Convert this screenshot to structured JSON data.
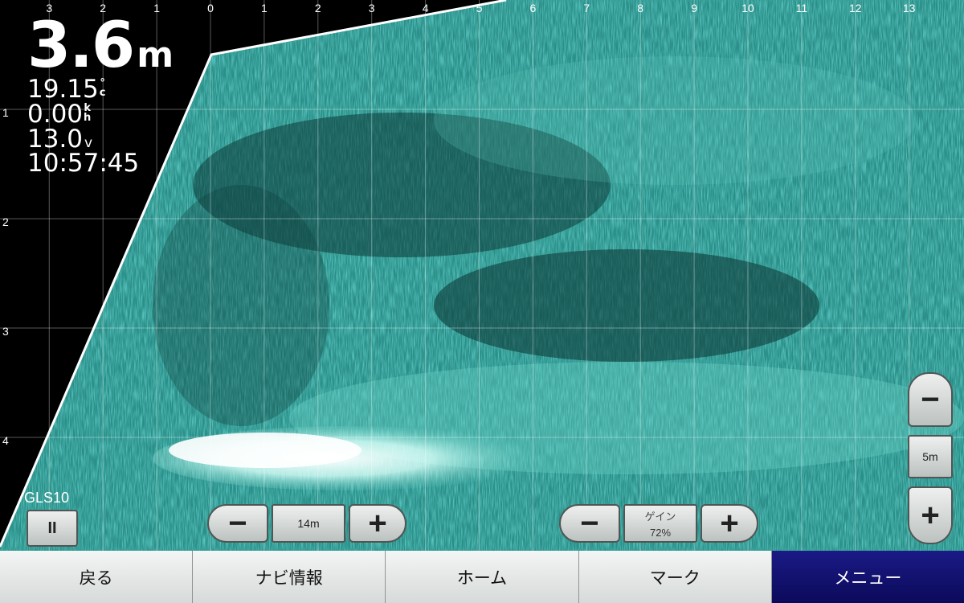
{
  "readouts": {
    "depth_value": "3.6",
    "depth_unit": "m",
    "temperature": "19.15",
    "temperature_unit_top": "°",
    "temperature_unit_bottom": "c",
    "speed": "0.00",
    "speed_unit_top": "k",
    "speed_unit_bottom": "h",
    "voltage": "13.0",
    "voltage_unit": "v",
    "time": "10:57:45"
  },
  "grid": {
    "x_labels": [
      "3",
      "2",
      "1",
      "0",
      "1",
      "2",
      "3",
      "4",
      "5",
      "6",
      "7",
      "8",
      "9",
      "10",
      "11",
      "12",
      "13"
    ],
    "y_labels": [
      "1",
      "2",
      "3",
      "4"
    ]
  },
  "sensor": {
    "name": "GLS10",
    "pause_icon": "pause-icon",
    "pause_symbol": "II"
  },
  "range_control": {
    "minus": "−",
    "value": "14m",
    "plus": "+"
  },
  "gain_control": {
    "minus": "−",
    "label": "ゲイン",
    "value": "72%",
    "plus": "+"
  },
  "zoom_control": {
    "minus": "−",
    "value": "5m",
    "plus": "+"
  },
  "bottom_nav": {
    "back": "戻る",
    "navi_info": "ナビ情報",
    "home": "ホーム",
    "mark": "マーク",
    "menu": "メニュー"
  },
  "colors": {
    "sonar_base": "#2a8f89",
    "sonar_bright": "#e9fffb",
    "nav_active": "#12117a"
  }
}
